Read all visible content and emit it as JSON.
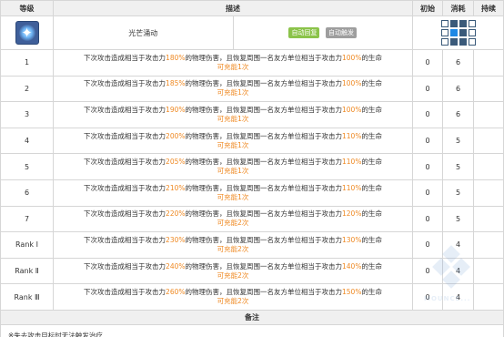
{
  "skill": {
    "name": "光芒涌动",
    "tags": [
      "自动回复",
      "自动触发"
    ]
  },
  "headers": {
    "level": "等级",
    "description": "描述",
    "initial": "初始",
    "cost": "消耗",
    "duration": "持续"
  },
  "rows": [
    {
      "level": "1",
      "atk": "180%",
      "heal": "100%",
      "charges": "1次",
      "initial": "0",
      "cost": "6",
      "duration": ""
    },
    {
      "level": "2",
      "atk": "185%",
      "heal": "100%",
      "charges": "1次",
      "initial": "0",
      "cost": "6",
      "duration": ""
    },
    {
      "level": "3",
      "atk": "190%",
      "heal": "100%",
      "charges": "1次",
      "initial": "0",
      "cost": "6",
      "duration": ""
    },
    {
      "level": "4",
      "atk": "200%",
      "heal": "110%",
      "charges": "1次",
      "initial": "0",
      "cost": "5",
      "duration": ""
    },
    {
      "level": "5",
      "atk": "205%",
      "heal": "110%",
      "charges": "1次",
      "initial": "0",
      "cost": "5",
      "duration": ""
    },
    {
      "level": "6",
      "atk": "210%",
      "heal": "110%",
      "charges": "1次",
      "initial": "0",
      "cost": "5",
      "duration": ""
    },
    {
      "level": "7",
      "atk": "220%",
      "heal": "120%",
      "charges": "2次",
      "initial": "0",
      "cost": "5",
      "duration": ""
    },
    {
      "level": "Rank Ⅰ",
      "atk": "230%",
      "heal": "130%",
      "charges": "2次",
      "initial": "0",
      "cost": "4",
      "duration": ""
    },
    {
      "level": "Rank Ⅱ",
      "atk": "240%",
      "heal": "140%",
      "charges": "2次",
      "initial": "0",
      "cost": "4",
      "duration": ""
    },
    {
      "level": "Rank Ⅲ",
      "atk": "260%",
      "heal": "150%",
      "charges": "2次",
      "initial": "0",
      "cost": "4",
      "duration": ""
    }
  ],
  "desc_parts": {
    "p1": "下次攻击造成相当于攻击力",
    "p2": "的物理伤害，且恢复周围一名友方单位相当于攻击力",
    "p3": "的生命",
    "charge_prefix": "可充能"
  },
  "notes": {
    "title": "备注",
    "text": "※失去攻击目标时无法触发治疗"
  },
  "watermark": "MOUNCE...",
  "colors": {
    "highlight": "#ef8a24",
    "tag_green": "#8bc34a",
    "tag_gray": "#9e9e9e",
    "range_self": "#1e88e5"
  }
}
